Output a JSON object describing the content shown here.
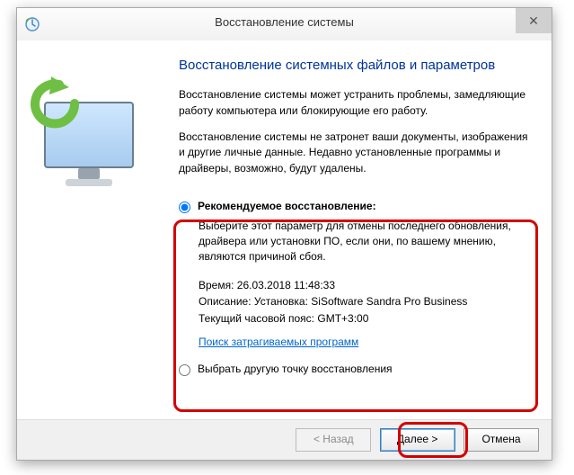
{
  "window": {
    "title": "Восстановление системы"
  },
  "heading": "Восстановление системных файлов и параметров",
  "para1": "Восстановление системы может устранить проблемы, замедляющие работу компьютера или блокирующие его работу.",
  "para2": "Восстановление системы не затронет ваши документы, изображения и другие личные данные. Недавно установленные программы и драйверы, возможно, будут удалены.",
  "option_recommended": {
    "label": "Рекомендуемое восстановление:",
    "description": "Выберите этот параметр для отмены последнего обновления, драйвера или установки ПО, если они, по вашему мнению, являются причиной сбоя.",
    "time_label": "Время:",
    "time_value": "26.03.2018 11:48:33",
    "desc_label": "Описание:",
    "desc_value": "Установка: SiSoftware Sandra Pro Business",
    "tz_label": "Текущий часовой пояс:",
    "tz_value": "GMT+3:00",
    "affected_link": "Поиск затрагиваемых программ"
  },
  "option_other": {
    "label": "Выбрать другую точку восстановления"
  },
  "buttons": {
    "back": "< Назад",
    "next": "Далее >",
    "cancel": "Отмена"
  },
  "close_glyph": "✕"
}
